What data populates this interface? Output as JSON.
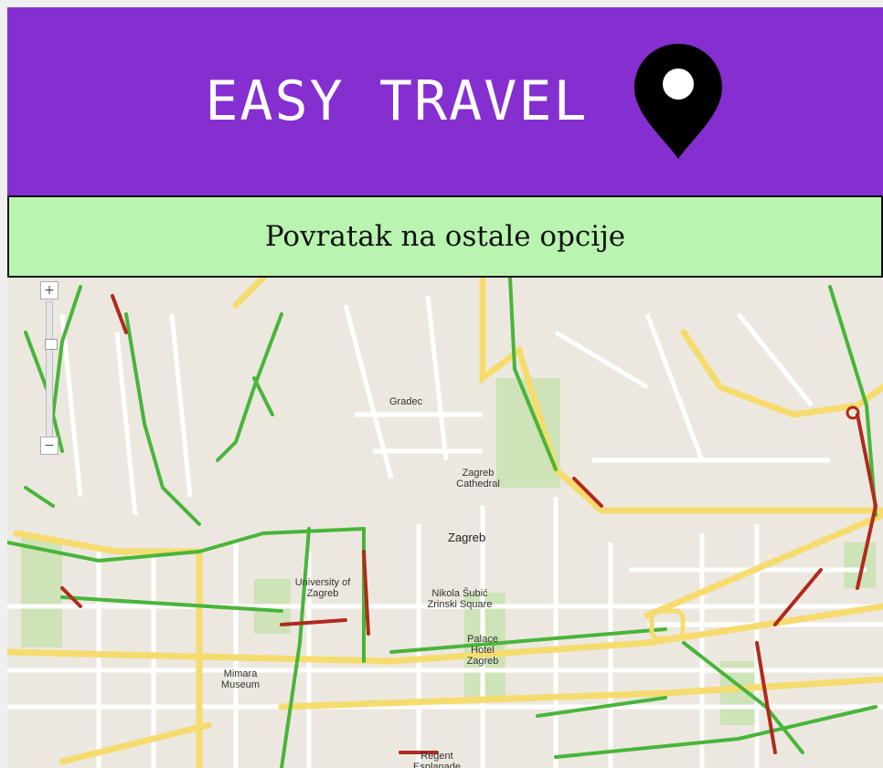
{
  "header": {
    "title": "EASY TRAVEL",
    "bg_color": "#852fd0",
    "icon": "map-pin-icon"
  },
  "nav": {
    "back_label": "Povratak na ostale opcije",
    "bg_color": "#b9f5b0"
  },
  "map": {
    "labels": {
      "city": "Zagreb",
      "gradec": "Gradec",
      "cathedral": "Zagreb Cathedral",
      "university": "University of Zagreb",
      "square": "Nikola Šubić Zrinski Square",
      "museum": "Mimara Museum",
      "regent": "Regent Esplanade",
      "palace": "Palace Hotel Zagreb"
    },
    "zoom": {
      "plus": "+",
      "minus": "−"
    }
  }
}
